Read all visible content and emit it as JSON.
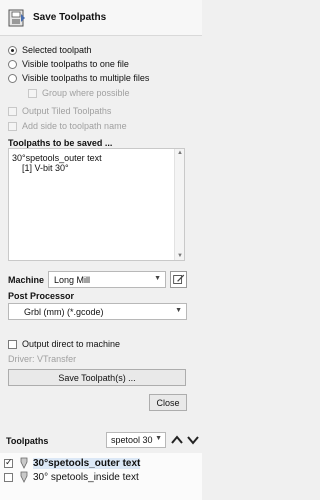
{
  "header": {
    "title": "Save Toolpaths"
  },
  "options": {
    "selected_toolpath": "Selected toolpath",
    "visible_one_file": "Visible toolpaths to one file",
    "visible_multiple_files": "Visible toolpaths to multiple files",
    "group_where_possible": "Group where possible",
    "output_tiled": "Output Tiled Toolpaths",
    "add_side": "Add side to toolpath name"
  },
  "to_save": {
    "title": "Toolpaths to be saved ...",
    "lines": [
      "30°spetools_outer text",
      "[1] V-bit 30°"
    ]
  },
  "machine": {
    "label": "Machine",
    "value": "Long Mill"
  },
  "post_processor": {
    "label": "Post Processor",
    "value": "Grbl (mm) (*.gcode)"
  },
  "output_direct": {
    "label": "Output direct to machine",
    "driver": "Driver: VTransfer"
  },
  "buttons": {
    "save": "Save Toolpath(s) ...",
    "close": "Close"
  },
  "toolpaths_panel": {
    "title": "Toolpaths",
    "filter": "spetool 30",
    "items": [
      {
        "label": "30°spetools_outer text",
        "checked": true
      },
      {
        "label": "30° spetools_inside text",
        "checked": false
      }
    ]
  },
  "colors": {
    "icon_blue": "#4a6fb0",
    "selection": "#dce8f6",
    "header_bg": "#f7f7f7"
  }
}
